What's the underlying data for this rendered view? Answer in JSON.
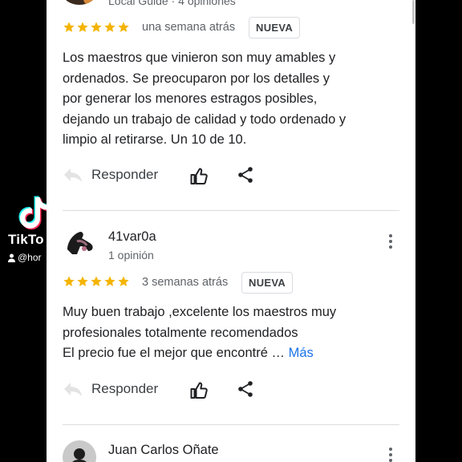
{
  "watermark": {
    "brand": "TikTo",
    "user": "@hor"
  },
  "colors": {
    "star": "#f4b400",
    "link": "#1a73e8",
    "text": "#202124",
    "muted": "#5f6368"
  },
  "reviews": [
    {
      "reviewer_sub": "Local Guide · 4 opiniones",
      "rating": 5,
      "date": "una semana atrás",
      "badge": "NUEVA",
      "lines": [
        "Los maestros que vinieron son muy amables y",
        "ordenados. Se preocuparon por los detalles y",
        "por generar los menores estragos posibles,",
        "dejando un trabajo de calidad y todo ordenado y",
        "limpio al retirarse. Un 10 de 10."
      ],
      "reply_label": "Responder"
    },
    {
      "reviewer_name": "41var0a",
      "reviewer_sub": "1 opinión",
      "rating": 5,
      "date": "3 semanas atrás",
      "badge": "NUEVA",
      "lines": [
        "Muy buen trabajo ,excelente los maestros muy",
        "profesionales totalmente recomendados",
        "El precio fue el mejor que encontré …"
      ],
      "more_label": "Más",
      "reply_label": "Responder"
    },
    {
      "reviewer_name": "Juan Carlos Oñate"
    }
  ],
  "icons": [
    "reply-arrow-icon",
    "thumbs-up-icon",
    "share-icon",
    "more-vert-icon",
    "star-icon",
    "tiktok-logo-icon",
    "person-icon"
  ]
}
